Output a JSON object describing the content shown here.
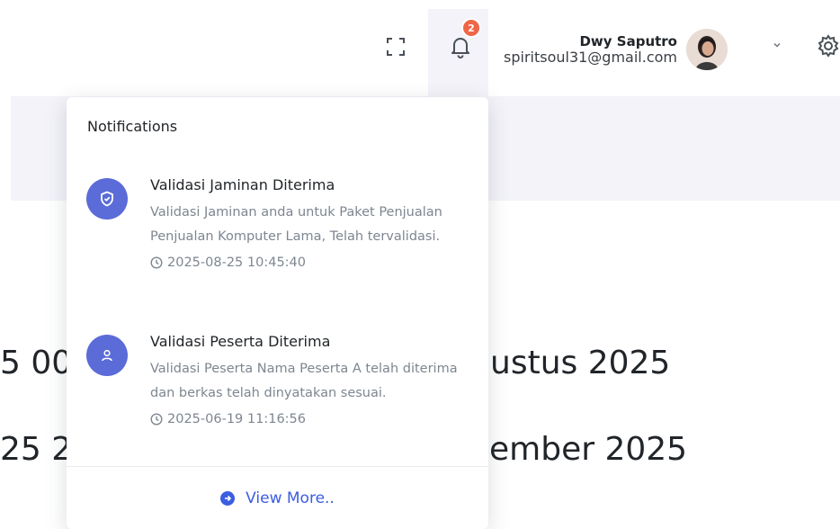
{
  "header": {
    "notification_count": "2",
    "user": {
      "name": "Dwy Saputro",
      "email": "spiritsoul31@gmail.com"
    }
  },
  "background": {
    "line1_left": "5 00",
    "line1_right": "ustus 2025",
    "line2_left": "25 2",
    "line2_right": "ember 2025"
  },
  "notifications": {
    "title": "Notifications",
    "items": [
      {
        "icon": "shield-check-icon",
        "title": "Validasi Jaminan Diterima",
        "description": "Validasi Jaminan anda untuk Paket Penjualan Penjualan Komputer Lama, Telah tervalidasi.",
        "time": "2025-08-25 10:45:40"
      },
      {
        "icon": "user-icon",
        "title": "Validasi Peserta Diterima",
        "description": "Validasi Peserta Nama Peserta A telah diterima dan berkas telah dinyatakan sesuai.",
        "time": "2025-06-19 11:16:56"
      }
    ],
    "view_more_label": "View More.."
  },
  "colors": {
    "accent": "#3b5ee0",
    "icon_bg": "#5b6bd8",
    "badge": "#f06548",
    "band": "#f3f3f9"
  }
}
